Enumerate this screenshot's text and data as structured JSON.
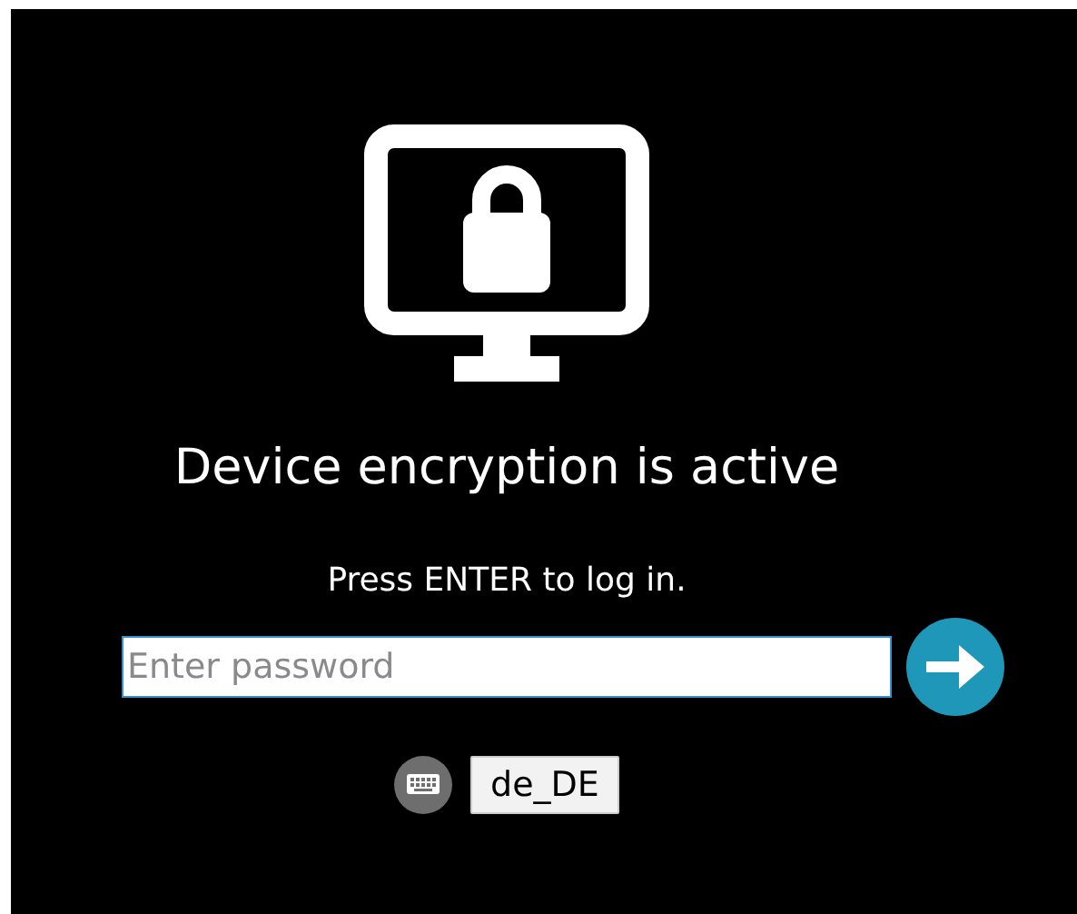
{
  "title": "Device encryption is active",
  "instruction": "Press ENTER to log in.",
  "password": {
    "placeholder": "Enter password"
  },
  "keyboard_layout": {
    "label": "de_DE"
  }
}
